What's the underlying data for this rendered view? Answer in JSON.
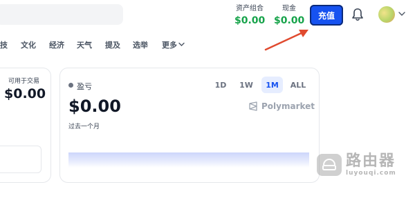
{
  "header": {
    "portfolio": {
      "label": "资产组合",
      "value": "$0.00"
    },
    "cash": {
      "label": "现金",
      "value": "$0.00"
    },
    "recharge_label": "充值",
    "icons": {
      "notifications": "bell-icon",
      "avatar": "avatar",
      "menu": "chevron-down-icon"
    }
  },
  "nav": {
    "items": [
      "技",
      "文化",
      "经济",
      "天气",
      "提及",
      "选举",
      "更多"
    ]
  },
  "left_card": {
    "label": "可用于交易",
    "value": "$0.00"
  },
  "pnl_card": {
    "label": "盈亏",
    "ranges": [
      "1D",
      "1W",
      "1M",
      "ALL"
    ],
    "active_range": "1M",
    "value": "$0.00",
    "period": "过去一个月",
    "brand": "Polymarket"
  },
  "watermark": {
    "main": "路由器",
    "sub": "luyouqi.com"
  },
  "colors": {
    "accent": "#1652f0",
    "positive": "#16a34a",
    "annotation": "#e04a2f"
  }
}
